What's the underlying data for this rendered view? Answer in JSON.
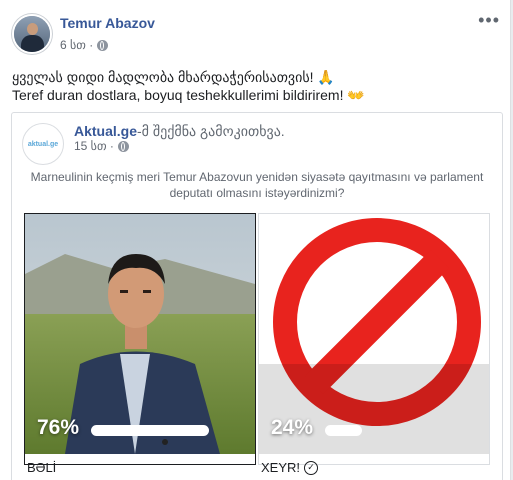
{
  "post": {
    "author": "Temur Abazov",
    "time": "6 სთ ·",
    "line1": "ყველას დიდი მადლობა მხარდაჭერისათვის! 🙏",
    "line2": "Teref duran dostlara, boyuq teshekkullerimi bildirirem! 👐",
    "more_icon": "more-dots-icon"
  },
  "shared": {
    "page_name": "Aktual.ge",
    "suffix": "-მ შექმნა გამოკითხვა.",
    "time": "15 სთ ·",
    "logo_text": "aktual.ge",
    "question": "Marneulinin keçmiş meri Temur Abazovun yenidən siyasətə qayıtmasını və parlament deputatı olmasını istəyərdinizmi?",
    "options": [
      {
        "percent": "76%",
        "fraction": 0.76,
        "label": "BƏLİ"
      },
      {
        "percent": "24%",
        "fraction": 0.24,
        "label": "XEYR!"
      }
    ]
  },
  "colors": {
    "link": "#385898",
    "no_sign": "#e8231e"
  }
}
